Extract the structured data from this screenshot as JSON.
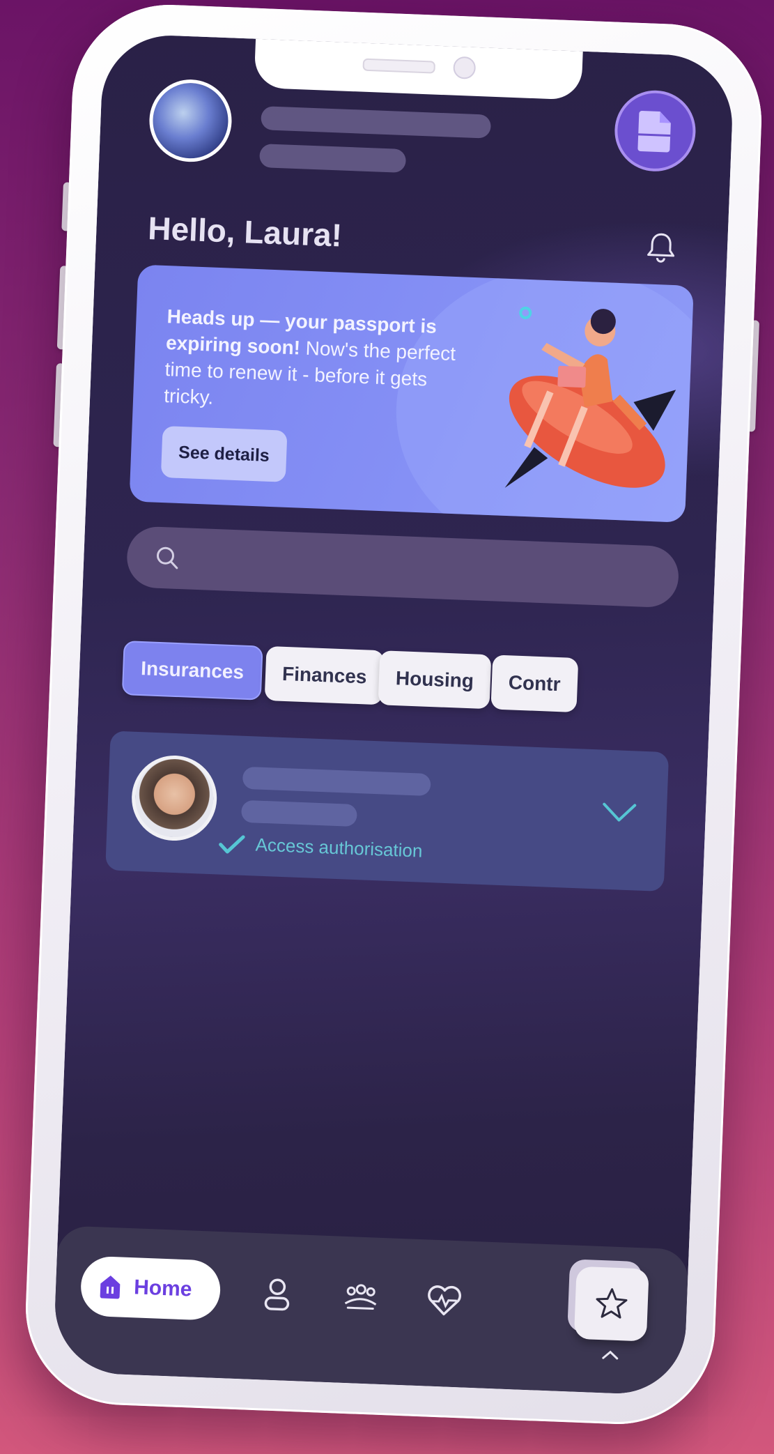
{
  "greeting": "Hello, Laura!",
  "banner": {
    "bold_text": "Heads up — your passport is expiring soon!",
    "text": " Now's the perfect time to renew it - before it gets tricky.",
    "button_label": "See details"
  },
  "search": {
    "placeholder": ""
  },
  "categories": [
    "Insurances",
    "Finances",
    "Housing",
    "Contr"
  ],
  "active_category": "Insurances",
  "card": {
    "access_label": "Access authorisation"
  },
  "nav": {
    "home_label": "Home"
  },
  "colors": {
    "accent": "#7d82ee",
    "nav_active": "#6b3fe0",
    "check": "#56c6d4",
    "card_bg": "#464a85"
  },
  "icons": [
    "document-icon",
    "bell-icon",
    "search-icon",
    "check-icon",
    "chevron-down-icon",
    "home-icon",
    "profile-icon",
    "group-icon",
    "heart-pulse-icon",
    "star-icon"
  ]
}
